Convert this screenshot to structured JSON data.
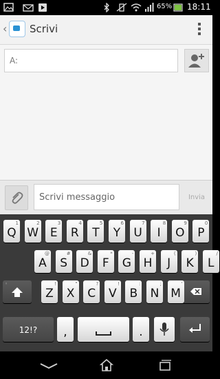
{
  "status_bar": {
    "battery": "65%",
    "time": "18:11"
  },
  "app_bar": {
    "title": "Scrivi"
  },
  "to_field": {
    "placeholder": "A:"
  },
  "compose": {
    "placeholder": "Scrivi messaggio",
    "send_label": "Invia"
  },
  "keyboard": {
    "row1": [
      {
        "k": "Q",
        "a": "1"
      },
      {
        "k": "W",
        "a": "2"
      },
      {
        "k": "E",
        "a": "3"
      },
      {
        "k": "R",
        "a": "4"
      },
      {
        "k": "T",
        "a": "5"
      },
      {
        "k": "Y",
        "a": "6"
      },
      {
        "k": "U",
        "a": "7"
      },
      {
        "k": "I",
        "a": "8"
      },
      {
        "k": "O",
        "a": "9"
      },
      {
        "k": "P",
        "a": "0"
      }
    ],
    "row2": [
      {
        "k": "A",
        "a": "@"
      },
      {
        "k": "S",
        "a": "#"
      },
      {
        "k": "D",
        "a": "&"
      },
      {
        "k": "F",
        "a": "*"
      },
      {
        "k": "G",
        "a": "-"
      },
      {
        "k": "H",
        "a": "+"
      },
      {
        "k": "J",
        "a": "("
      },
      {
        "k": "K",
        "a": ")"
      },
      {
        "k": "L",
        "a": "/"
      }
    ],
    "row3": [
      {
        "k": "Z",
        "a": "!"
      },
      {
        "k": "X",
        "a": "\""
      },
      {
        "k": "C",
        "a": "?"
      },
      {
        "k": "V",
        "a": "!"
      },
      {
        "k": "B",
        "a": ":"
      },
      {
        "k": "N",
        "a": ";"
      },
      {
        "k": "M",
        "a": "'"
      }
    ],
    "symbols_label": "12!?",
    "comma": ",",
    "period": "."
  },
  "colors": {
    "accent": "#2a92d4",
    "keyboard_bg": "#3a3a3a"
  },
  "icons": {
    "status_left": [
      "image-icon",
      "email-icon",
      "play-store-icon"
    ],
    "status_right": [
      "bluetooth-icon",
      "vibrate-icon",
      "wifi-icon",
      "signal-icon",
      "battery-icon"
    ],
    "nav": [
      "back-icon",
      "home-icon",
      "recent-apps-icon"
    ]
  }
}
